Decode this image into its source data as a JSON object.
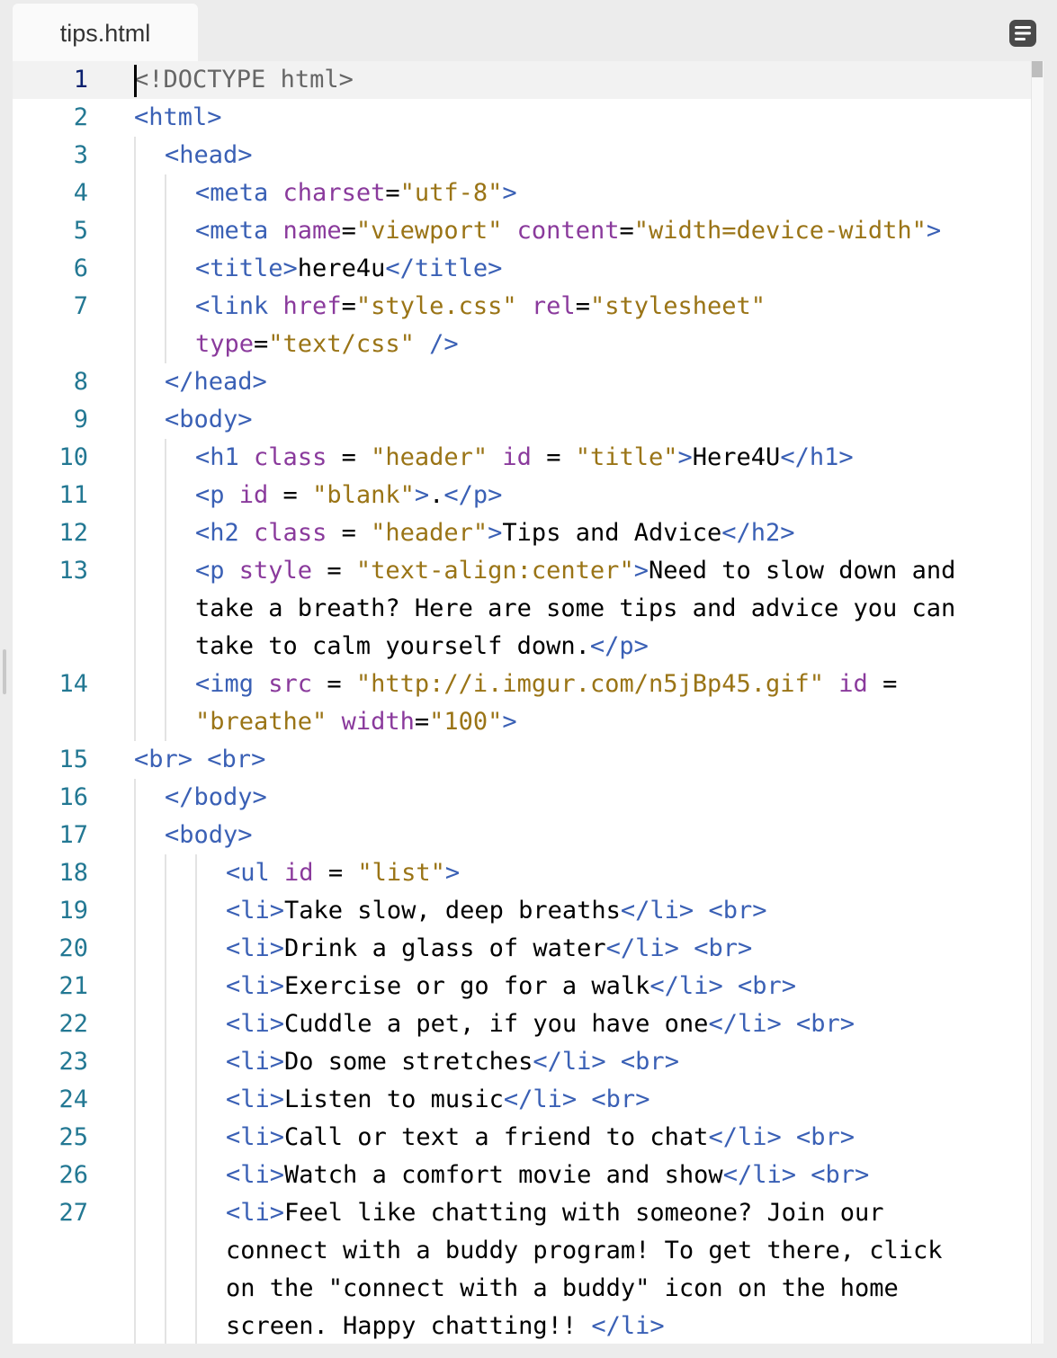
{
  "tab": {
    "title": "tips.html"
  },
  "editor": {
    "lines": [
      {
        "num": "1",
        "indent": 0,
        "segs": [
          [
            "g",
            "<!DOCTYPE"
          ],
          [
            "c",
            " "
          ],
          [
            "g",
            "html"
          ],
          [
            "g",
            ">"
          ]
        ]
      },
      {
        "num": "2",
        "indent": 0,
        "segs": [
          [
            "t",
            "<html>"
          ]
        ]
      },
      {
        "num": "3",
        "indent": 1,
        "segs": [
          [
            "t",
            "<head>"
          ]
        ]
      },
      {
        "num": "4",
        "indent": 2,
        "segs": [
          [
            "t",
            "<meta"
          ],
          [
            "c",
            " "
          ],
          [
            "a",
            "charset"
          ],
          [
            "c",
            "="
          ],
          [
            "s",
            "\"utf-8\""
          ],
          [
            "t",
            ">"
          ]
        ]
      },
      {
        "num": "5",
        "indent": 2,
        "segs": [
          [
            "t",
            "<meta"
          ],
          [
            "c",
            " "
          ],
          [
            "a",
            "name"
          ],
          [
            "c",
            "="
          ],
          [
            "s",
            "\"viewport\""
          ],
          [
            "c",
            " "
          ],
          [
            "a",
            "content"
          ],
          [
            "c",
            "="
          ],
          [
            "s",
            "\"width=device-width\""
          ],
          [
            "t",
            ">"
          ]
        ]
      },
      {
        "num": "6",
        "indent": 2,
        "segs": [
          [
            "t",
            "<title>"
          ],
          [
            "c",
            "here4u"
          ],
          [
            "t",
            "</title>"
          ]
        ]
      },
      {
        "num": "7",
        "indent": 2,
        "segs": [
          [
            "t",
            "<link"
          ],
          [
            "c",
            " "
          ],
          [
            "a",
            "href"
          ],
          [
            "c",
            "="
          ],
          [
            "s",
            "\"style.css\""
          ],
          [
            "c",
            " "
          ],
          [
            "a",
            "rel"
          ],
          [
            "c",
            "="
          ],
          [
            "s",
            "\"stylesheet\""
          ]
        ]
      },
      {
        "num": "",
        "indent": 2,
        "segs": [
          [
            "a",
            "type"
          ],
          [
            "c",
            "="
          ],
          [
            "s",
            "\"text/css\""
          ],
          [
            "c",
            " "
          ],
          [
            "t",
            "/>"
          ]
        ]
      },
      {
        "num": "8",
        "indent": 1,
        "segs": [
          [
            "t",
            "</head>"
          ]
        ]
      },
      {
        "num": "9",
        "indent": 1,
        "segs": [
          [
            "t",
            "<body>"
          ]
        ]
      },
      {
        "num": "10",
        "indent": 2,
        "segs": [
          [
            "t",
            "<h1"
          ],
          [
            "c",
            " "
          ],
          [
            "a",
            "class"
          ],
          [
            "c",
            " = "
          ],
          [
            "s",
            "\"header\""
          ],
          [
            "c",
            " "
          ],
          [
            "a",
            "id"
          ],
          [
            "c",
            " = "
          ],
          [
            "s",
            "\"title\""
          ],
          [
            "t",
            ">"
          ],
          [
            "c",
            "Here4U"
          ],
          [
            "t",
            "</h1>"
          ]
        ]
      },
      {
        "num": "11",
        "indent": 2,
        "segs": [
          [
            "t",
            "<p"
          ],
          [
            "c",
            " "
          ],
          [
            "a",
            "id"
          ],
          [
            "c",
            " = "
          ],
          [
            "s",
            "\"blank\""
          ],
          [
            "t",
            ">"
          ],
          [
            "c",
            "."
          ],
          [
            "t",
            "</p>"
          ]
        ]
      },
      {
        "num": "12",
        "indent": 2,
        "segs": [
          [
            "t",
            "<h2"
          ],
          [
            "c",
            " "
          ],
          [
            "a",
            "class"
          ],
          [
            "c",
            " = "
          ],
          [
            "s",
            "\"header\""
          ],
          [
            "t",
            ">"
          ],
          [
            "c",
            "Tips and Advice"
          ],
          [
            "t",
            "</h2>"
          ]
        ]
      },
      {
        "num": "13",
        "indent": 2,
        "segs": [
          [
            "t",
            "<p"
          ],
          [
            "c",
            " "
          ],
          [
            "a",
            "style"
          ],
          [
            "c",
            " = "
          ],
          [
            "s",
            "\"text-align:center\""
          ],
          [
            "t",
            ">"
          ],
          [
            "c",
            "Need to slow down and"
          ]
        ]
      },
      {
        "num": "",
        "indent": 2,
        "segs": [
          [
            "c",
            "take a breath? Here are some tips and advice you can"
          ]
        ]
      },
      {
        "num": "",
        "indent": 2,
        "segs": [
          [
            "c",
            "take to calm yourself down."
          ],
          [
            "t",
            "</p>"
          ]
        ]
      },
      {
        "num": "14",
        "indent": 2,
        "segs": [
          [
            "t",
            "<img"
          ],
          [
            "c",
            " "
          ],
          [
            "a",
            "src"
          ],
          [
            "c",
            " = "
          ],
          [
            "s",
            "\"http://i.imgur.com/n5jBp45.gif\""
          ],
          [
            "c",
            " "
          ],
          [
            "a",
            "id"
          ],
          [
            "c",
            " ="
          ]
        ]
      },
      {
        "num": "",
        "indent": 2,
        "segs": [
          [
            "s",
            "\"breathe\""
          ],
          [
            "c",
            " "
          ],
          [
            "a",
            "width"
          ],
          [
            "c",
            "="
          ],
          [
            "s",
            "\"100\""
          ],
          [
            "t",
            ">"
          ]
        ]
      },
      {
        "num": "15",
        "indent": 0,
        "segs": [
          [
            "t",
            "<br>"
          ],
          [
            "c",
            " "
          ],
          [
            "t",
            "<br>"
          ]
        ]
      },
      {
        "num": "16",
        "indent": 1,
        "segs": [
          [
            "t",
            "</body>"
          ]
        ]
      },
      {
        "num": "17",
        "indent": 1,
        "segs": [
          [
            "t",
            "<body>"
          ]
        ]
      },
      {
        "num": "18",
        "indent": 3,
        "segs": [
          [
            "t",
            "<ul"
          ],
          [
            "c",
            " "
          ],
          [
            "a",
            "id"
          ],
          [
            "c",
            " = "
          ],
          [
            "s",
            "\"list\""
          ],
          [
            "t",
            ">"
          ]
        ]
      },
      {
        "num": "19",
        "indent": 3,
        "segs": [
          [
            "t",
            "<li>"
          ],
          [
            "c",
            "Take slow, deep breaths"
          ],
          [
            "t",
            "</li>"
          ],
          [
            "c",
            " "
          ],
          [
            "t",
            "<br>"
          ]
        ]
      },
      {
        "num": "20",
        "indent": 3,
        "segs": [
          [
            "t",
            "<li>"
          ],
          [
            "c",
            "Drink a glass of water"
          ],
          [
            "t",
            "</li>"
          ],
          [
            "c",
            " "
          ],
          [
            "t",
            "<br>"
          ]
        ]
      },
      {
        "num": "21",
        "indent": 3,
        "segs": [
          [
            "t",
            "<li>"
          ],
          [
            "c",
            "Exercise or go for a walk"
          ],
          [
            "t",
            "</li>"
          ],
          [
            "c",
            " "
          ],
          [
            "t",
            "<br>"
          ]
        ]
      },
      {
        "num": "22",
        "indent": 3,
        "segs": [
          [
            "t",
            "<li>"
          ],
          [
            "c",
            "Cuddle a pet, if you have one"
          ],
          [
            "t",
            "</li>"
          ],
          [
            "c",
            " "
          ],
          [
            "t",
            "<br>"
          ]
        ]
      },
      {
        "num": "23",
        "indent": 3,
        "segs": [
          [
            "t",
            "<li>"
          ],
          [
            "c",
            "Do some stretches"
          ],
          [
            "t",
            "</li>"
          ],
          [
            "c",
            " "
          ],
          [
            "t",
            "<br>"
          ]
        ]
      },
      {
        "num": "24",
        "indent": 3,
        "segs": [
          [
            "t",
            "<li>"
          ],
          [
            "c",
            "Listen to music"
          ],
          [
            "t",
            "</li>"
          ],
          [
            "c",
            " "
          ],
          [
            "t",
            "<br>"
          ]
        ]
      },
      {
        "num": "25",
        "indent": 3,
        "segs": [
          [
            "t",
            "<li>"
          ],
          [
            "c",
            "Call or text a friend to chat"
          ],
          [
            "t",
            "</li>"
          ],
          [
            "c",
            " "
          ],
          [
            "t",
            "<br>"
          ]
        ]
      },
      {
        "num": "26",
        "indent": 3,
        "segs": [
          [
            "t",
            "<li>"
          ],
          [
            "c",
            "Watch a comfort movie and show"
          ],
          [
            "t",
            "</li>"
          ],
          [
            "c",
            " "
          ],
          [
            "t",
            "<br>"
          ]
        ]
      },
      {
        "num": "27",
        "indent": 3,
        "segs": [
          [
            "t",
            "<li>"
          ],
          [
            "c",
            "Feel like chatting with someone? Join our"
          ]
        ]
      },
      {
        "num": "",
        "indent": 3,
        "segs": [
          [
            "c",
            "connect with a buddy program! To get there, click"
          ]
        ]
      },
      {
        "num": "",
        "indent": 3,
        "segs": [
          [
            "c",
            "on the \"connect with a buddy\" icon on the home"
          ]
        ]
      },
      {
        "num": "",
        "indent": 3,
        "segs": [
          [
            "c",
            "screen. Happy chatting!! "
          ],
          [
            "t",
            "</li>"
          ]
        ]
      }
    ]
  }
}
